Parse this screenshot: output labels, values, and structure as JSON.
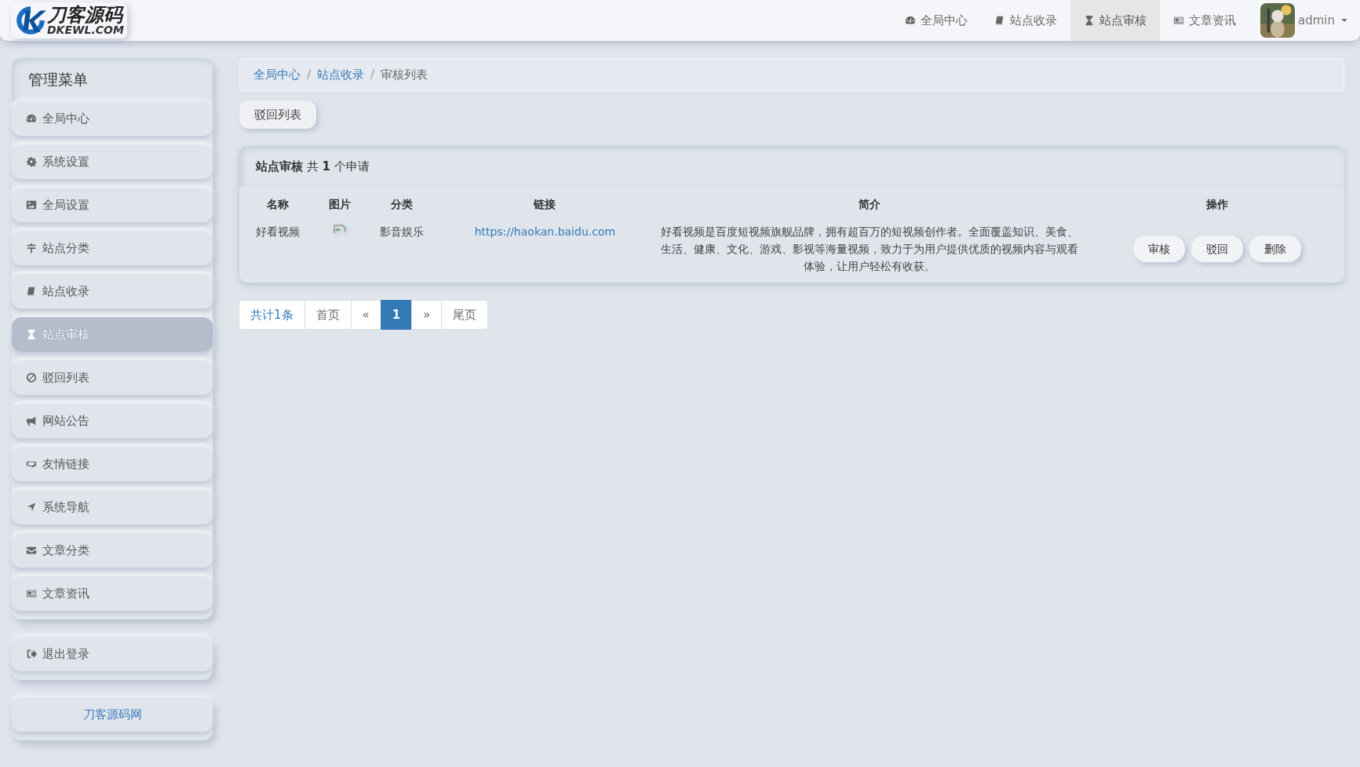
{
  "logo": {
    "title": "刀客源码",
    "subtitle": "DKEWL.COM"
  },
  "top_nav": [
    {
      "label": "全局中心",
      "selected": false
    },
    {
      "label": "站点收录",
      "selected": false
    },
    {
      "label": "站点审核",
      "selected": true
    },
    {
      "label": "文章资讯",
      "selected": false
    }
  ],
  "user": {
    "name": "admin"
  },
  "sidebar": {
    "title": "管理菜单",
    "items": [
      {
        "label": "全局中心",
        "selected": false
      },
      {
        "label": "系统设置",
        "selected": false
      },
      {
        "label": "全局设置",
        "selected": false
      },
      {
        "label": "站点分类",
        "selected": false
      },
      {
        "label": "站点收录",
        "selected": false
      },
      {
        "label": "站点审核",
        "selected": true
      },
      {
        "label": "驳回列表",
        "selected": false
      },
      {
        "label": "网站公告",
        "selected": false
      },
      {
        "label": "友情链接",
        "selected": false
      },
      {
        "label": "系统导航",
        "selected": false
      },
      {
        "label": "文章分类",
        "selected": false
      },
      {
        "label": "文章资讯",
        "selected": false
      }
    ],
    "logout": "退出登录",
    "footer_link": "刀客源码网"
  },
  "breadcrumb": [
    {
      "label": "全局中心",
      "link": true
    },
    {
      "separator": "/",
      "label": "站点收录",
      "link": true
    },
    {
      "separator": "/",
      "label": "审核列表",
      "link": false
    }
  ],
  "tab_button": "驳回列表",
  "panel": {
    "title": "**站点审核** 共 **1** 个申请",
    "columns": [
      "名称",
      "图片",
      "分类",
      "链接",
      "简介",
      "操作"
    ],
    "rows": [
      {
        "name": "好看视频",
        "category": "影音娱乐",
        "link": "https://haokan.baidu.com",
        "summary": "好看视频是百度短视频旗舰品牌，拥有超百万的短视频创作者。全面覆盖知识、美食、生活、健康、文化、游戏、影视等海量视频，致力于为用户提供优质的视频内容与观看体验，让用户轻松有收获。",
        "actions": [
          "审核",
          "驳回",
          "删除"
        ]
      }
    ]
  },
  "pagination": [
    {
      "label": "共计1条",
      "kind": "info",
      "selected": false
    },
    {
      "label": "首页",
      "kind": "page",
      "selected": false
    },
    {
      "label": "«",
      "kind": "page",
      "selected": false
    },
    {
      "label": "1",
      "kind": "page",
      "selected": true
    },
    {
      "label": "»",
      "kind": "page",
      "selected": false
    },
    {
      "label": "尾页",
      "kind": "page",
      "selected": false
    }
  ]
}
